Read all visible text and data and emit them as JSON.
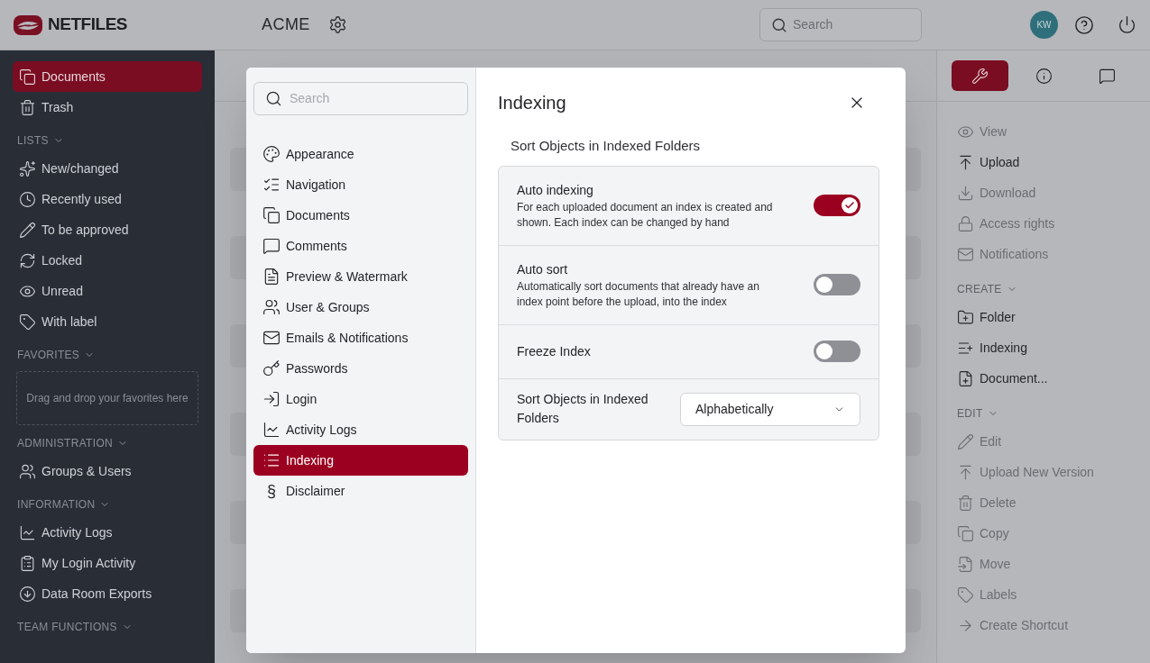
{
  "header": {
    "logo_text": "NETFILES",
    "workspace": "ACME",
    "search_placeholder": "Search",
    "avatar": "KW"
  },
  "sidebar": {
    "sections": [
      {
        "kind": "list",
        "items": [
          {
            "label": "Documents",
            "selected": true
          },
          {
            "label": "Trash",
            "selected": false
          }
        ]
      },
      {
        "kind": "list",
        "title": "LISTS",
        "items": [
          {
            "label": "New/changed",
            "selected": false
          },
          {
            "label": "Recently used",
            "selected": false
          },
          {
            "label": "To be approved",
            "selected": false
          },
          {
            "label": "Locked",
            "selected": false
          },
          {
            "label": "Unread",
            "selected": false
          },
          {
            "label": "With label",
            "selected": false
          }
        ]
      },
      {
        "kind": "dropzone",
        "title": "FAVORITES",
        "text": "Drag and drop your favorites here"
      },
      {
        "kind": "list",
        "title": "ADMINISTRATION",
        "items": [
          {
            "label": "Groups & Users",
            "selected": false
          }
        ]
      },
      {
        "kind": "list",
        "title": "INFORMATION",
        "items": [
          {
            "label": "Activity Logs",
            "selected": false
          },
          {
            "label": "My Login Activity",
            "selected": false
          },
          {
            "label": "Data Room Exports",
            "selected": false
          }
        ]
      },
      {
        "kind": "list",
        "title": "TEAM FUNCTIONS"
      }
    ]
  },
  "right_panel": {
    "tabs": [
      {
        "selected": true
      },
      {
        "selected": false
      },
      {
        "selected": false
      }
    ],
    "sections": [
      {
        "items": [
          {
            "label": "View",
            "disabled": true
          },
          {
            "label": "Upload",
            "disabled": false
          },
          {
            "label": "Download",
            "disabled": true
          },
          {
            "label": "Access rights",
            "disabled": true
          },
          {
            "label": "Notifications",
            "disabled": true
          }
        ]
      },
      {
        "title": "CREATE",
        "items": [
          {
            "label": "Folder",
            "disabled": false
          },
          {
            "label": "Indexing",
            "disabled": false
          },
          {
            "label": "Document...",
            "disabled": false
          }
        ]
      },
      {
        "title": "EDIT",
        "items": [
          {
            "label": "Edit",
            "disabled": true
          },
          {
            "label": "Upload New Version",
            "disabled": true
          },
          {
            "label": "Delete",
            "disabled": true
          },
          {
            "label": "Copy",
            "disabled": true
          },
          {
            "label": "Move",
            "disabled": true
          },
          {
            "label": "Labels",
            "disabled": true
          },
          {
            "label": "Create Shortcut",
            "disabled": true
          }
        ]
      }
    ]
  },
  "dialog": {
    "search_placeholder": "Search",
    "nav": [
      {
        "label": "Appearance",
        "selected": false
      },
      {
        "label": "Navigation",
        "selected": false
      },
      {
        "label": "Documents",
        "selected": false
      },
      {
        "label": "Comments",
        "selected": false
      },
      {
        "label": "Preview & Watermark",
        "selected": false
      },
      {
        "label": "User & Groups",
        "selected": false
      },
      {
        "label": "Emails & Notifications",
        "selected": false
      },
      {
        "label": "Passwords",
        "selected": false
      },
      {
        "label": "Login",
        "selected": false
      },
      {
        "label": "Activity Logs",
        "selected": false
      },
      {
        "label": "Indexing",
        "selected": true
      },
      {
        "label": "Disclaimer",
        "selected": false,
        "glyph": "§"
      }
    ],
    "title": "Indexing",
    "subtitle": "Sort Objects in Indexed Folders",
    "settings": [
      {
        "kind": "toggle",
        "label": "Auto indexing",
        "description": "For each uploaded document an index is created and shown. Each index can be changed by hand",
        "on": true
      },
      {
        "kind": "toggle",
        "label": "Auto sort",
        "description": "Automatically sort documents that already have an index point before the upload, into the index",
        "on": false
      },
      {
        "kind": "toggle",
        "label": "Freeze Index",
        "on": false
      },
      {
        "kind": "select",
        "label": "Sort Objects in Indexed Folders",
        "value": "Alphabetically"
      }
    ]
  }
}
